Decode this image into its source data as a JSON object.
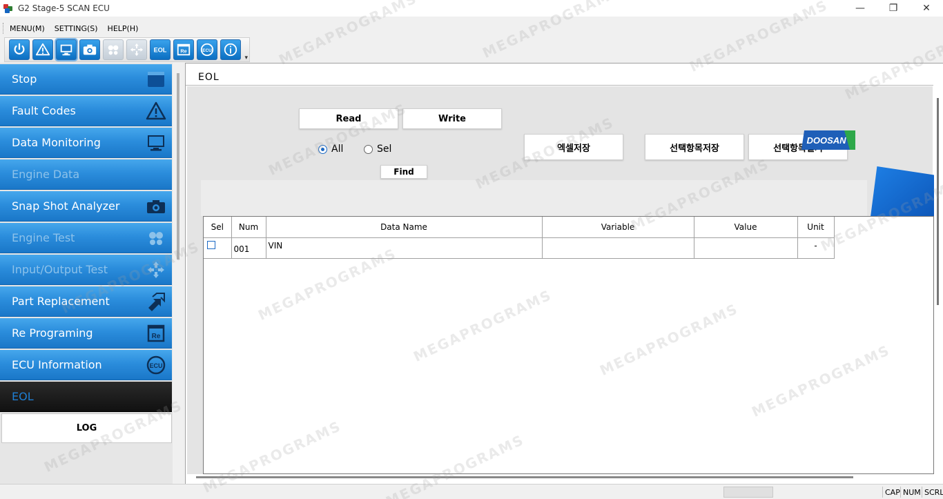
{
  "window": {
    "title": "G2 Stage-5 SCAN ECU",
    "controls": [
      "—",
      "❐",
      "✕"
    ]
  },
  "menu": [
    "MENU(M)",
    "SETTING(S)",
    "HELP(H)"
  ],
  "toolbar": {
    "buttons": [
      {
        "name": "power-icon",
        "enabled": true
      },
      {
        "name": "fault-warning-icon",
        "enabled": true
      },
      {
        "name": "monitor-icon",
        "enabled": true,
        "active": true
      },
      {
        "name": "camera-icon",
        "enabled": true
      },
      {
        "name": "engine-test-icon",
        "enabled": false
      },
      {
        "name": "io-test-icon",
        "enabled": false
      },
      {
        "name": "eol-icon",
        "enabled": true,
        "text": "EOL"
      },
      {
        "name": "re-program-icon",
        "enabled": true,
        "text": "Re"
      },
      {
        "name": "ecu-icon",
        "enabled": true,
        "text": "ECU"
      },
      {
        "name": "info-icon",
        "enabled": true
      }
    ]
  },
  "sidebar": {
    "items": [
      {
        "label": "Stop",
        "icon": "stop-icon",
        "enabled": true
      },
      {
        "label": "Fault Codes",
        "icon": "warning-icon",
        "enabled": true
      },
      {
        "label": "Data Monitoring",
        "icon": "monitor-icon",
        "enabled": true
      },
      {
        "label": "Engine Data",
        "icon": "",
        "enabled": false
      },
      {
        "label": "Snap Shot Analyzer",
        "icon": "camera-icon",
        "enabled": true
      },
      {
        "label": "Engine Test",
        "icon": "engine-test-icon",
        "enabled": false
      },
      {
        "label": "Input/Output Test",
        "icon": "io-test-icon",
        "enabled": false
      },
      {
        "label": "Part Replacement",
        "icon": "part-replacement-icon",
        "enabled": true
      },
      {
        "label": "Re Programing",
        "icon": "re-program-icon",
        "enabled": true
      },
      {
        "label": "ECU Information",
        "icon": "ecu-icon",
        "enabled": true
      },
      {
        "label": "EOL",
        "icon": "",
        "enabled": true,
        "selected": true
      }
    ],
    "log_label": "LOG"
  },
  "main": {
    "section_title": "EOL",
    "read_label": "Read",
    "write_label": "Write",
    "radio_all": "All",
    "radio_sel": "Sel",
    "radio_selected": "All",
    "find_label": "Find",
    "search_value": "",
    "excel_save_label": "엑셀저장",
    "save_selected_label": "선택항목저장",
    "open_selected_label": "선택항목열기",
    "brand": "DOOSAN",
    "brand_color": "#1f5fb8",
    "accent_green": "#2ea84a"
  },
  "table": {
    "columns": [
      "Sel",
      "Num",
      "Data Name",
      "Variable",
      "Value",
      "Unit"
    ],
    "rows": [
      {
        "sel": false,
        "num": "001",
        "data_name": "VIN",
        "variable": "",
        "value": "",
        "unit": "-"
      }
    ]
  },
  "statusbar": {
    "cap": "CAP",
    "num": "NUM",
    "scrl": "SCRL"
  },
  "watermark": "MEGAPROGRAMS"
}
